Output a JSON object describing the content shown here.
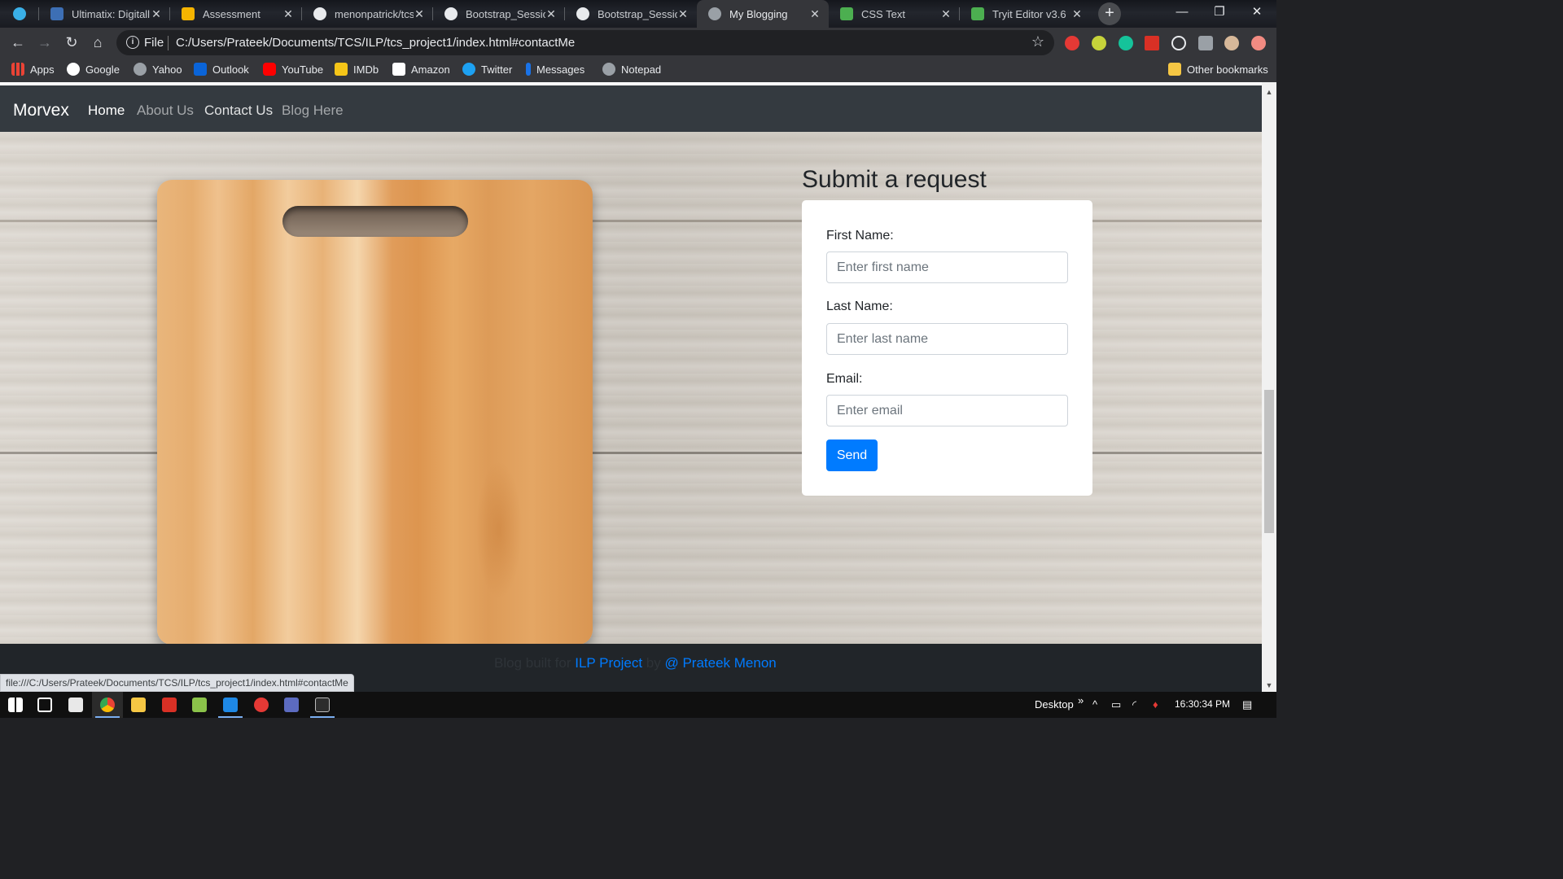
{
  "browser": {
    "tabs": [
      {
        "title": "",
        "favicon_color": "#3ab0e8"
      },
      {
        "title": "Ultimatix: Digitall",
        "favicon_color": "#3d6fb5"
      },
      {
        "title": "Assessment",
        "favicon_color": "#f5b400"
      },
      {
        "title": "menonpatrick/tcs",
        "favicon_color": "#e8eaed"
      },
      {
        "title": "Bootstrap_Session",
        "favicon_color": "#e8eaed"
      },
      {
        "title": "Bootstrap_Session",
        "favicon_color": "#e8eaed"
      },
      {
        "title": "My Blogging",
        "favicon_color": "#9aa0a6"
      },
      {
        "title": "CSS Text",
        "favicon_color": "#4caf50"
      },
      {
        "title": "Tryit Editor v3.6",
        "favicon_color": "#4caf50"
      }
    ],
    "new_tab": "+",
    "window_controls": {
      "minimize": "—",
      "restore": "❐",
      "close": "✕"
    },
    "address": {
      "scheme_label": "File",
      "url": "C:/Users/Prateek/Documents/TCS/ILP/tcs_project1/index.html#contactMe"
    },
    "bookmarks": [
      {
        "label": "Apps",
        "icon_color": "#4285f4"
      },
      {
        "label": "Google",
        "icon_color": "#ffffff"
      },
      {
        "label": "Yahoo",
        "icon_color": "#9aa0a6"
      },
      {
        "label": "Outlook",
        "icon_color": "#0a64d8"
      },
      {
        "label": "YouTube",
        "icon_color": "#ff0000"
      },
      {
        "label": "IMDb",
        "icon_color": "#f5c518"
      },
      {
        "label": "Amazon",
        "icon_color": "#ffffff"
      },
      {
        "label": "Twitter",
        "icon_color": "#1da1f2"
      },
      {
        "label": "Messages",
        "icon_color": "#1a73e8"
      },
      {
        "label": "Notepad",
        "icon_color": "#9aa0a6"
      }
    ],
    "other_bookmarks": "Other bookmarks",
    "status_url": "file:///C:/Users/Prateek/Documents/TCS/ILP/tcs_project1/index.html#contactMe"
  },
  "site": {
    "brand": "Morvex",
    "nav": [
      "Home",
      "About Us",
      "Contact Us",
      "Blog Here"
    ],
    "form": {
      "title": "Submit a request",
      "first_name_label": "First Name:",
      "first_name_placeholder": "Enter first name",
      "last_name_label": "Last Name:",
      "last_name_placeholder": "Enter last name",
      "email_label": "Email:",
      "email_placeholder": "Enter email",
      "submit": "Send"
    },
    "footer": {
      "text_a": "Blog built for ",
      "link_a": "ILP Project",
      "text_b": " by ",
      "link_b": "@ Prateek Menon"
    }
  },
  "taskbar": {
    "desktop_label": "Desktop",
    "time": "16:30:34 PM"
  },
  "colors": {
    "navbar_bg": "#343a40",
    "primary": "#007bff",
    "footer_bg": "#212529"
  }
}
